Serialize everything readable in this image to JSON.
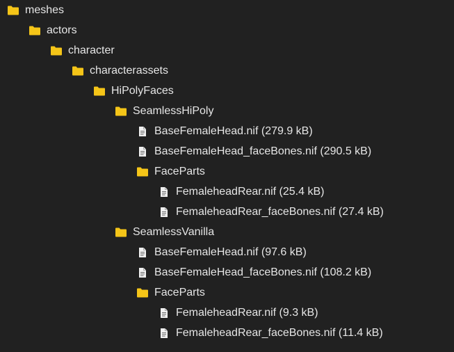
{
  "colors": {
    "background": "#212121",
    "text": "#e6e6e6",
    "folder": "#f5c518",
    "file": "#f0f0f0"
  },
  "tree": [
    {
      "type": "folder",
      "depth": 0,
      "label": "meshes",
      "icon": "folder-icon"
    },
    {
      "type": "folder",
      "depth": 1,
      "label": "actors",
      "icon": "folder-icon"
    },
    {
      "type": "folder",
      "depth": 2,
      "label": "character",
      "icon": "folder-icon"
    },
    {
      "type": "folder",
      "depth": 3,
      "label": "characterassets",
      "icon": "folder-icon"
    },
    {
      "type": "folder",
      "depth": 4,
      "label": "HiPolyFaces",
      "icon": "folder-icon"
    },
    {
      "type": "folder",
      "depth": 5,
      "label": "SeamlessHiPoly",
      "icon": "folder-icon"
    },
    {
      "type": "file",
      "depth": 6,
      "label": "BaseFemaleHead.nif (279.9 kB)",
      "icon": "file-icon"
    },
    {
      "type": "file",
      "depth": 6,
      "label": "BaseFemaleHead_faceBones.nif (290.5 kB)",
      "icon": "file-icon"
    },
    {
      "type": "folder",
      "depth": 6,
      "label": "FaceParts",
      "icon": "folder-icon"
    },
    {
      "type": "file",
      "depth": 7,
      "label": "FemaleheadRear.nif (25.4 kB)",
      "icon": "file-icon"
    },
    {
      "type": "file",
      "depth": 7,
      "label": "FemaleheadRear_faceBones.nif (27.4 kB)",
      "icon": "file-icon"
    },
    {
      "type": "folder",
      "depth": 5,
      "label": "SeamlessVanilla",
      "icon": "folder-icon"
    },
    {
      "type": "file",
      "depth": 6,
      "label": "BaseFemaleHead.nif (97.6 kB)",
      "icon": "file-icon"
    },
    {
      "type": "file",
      "depth": 6,
      "label": "BaseFemaleHead_faceBones.nif (108.2 kB)",
      "icon": "file-icon"
    },
    {
      "type": "folder",
      "depth": 6,
      "label": "FaceParts",
      "icon": "folder-icon"
    },
    {
      "type": "file",
      "depth": 7,
      "label": "FemaleheadRear.nif (9.3 kB)",
      "icon": "file-icon"
    },
    {
      "type": "file",
      "depth": 7,
      "label": "FemaleheadRear_faceBones.nif (11.4 kB)",
      "icon": "file-icon"
    }
  ]
}
